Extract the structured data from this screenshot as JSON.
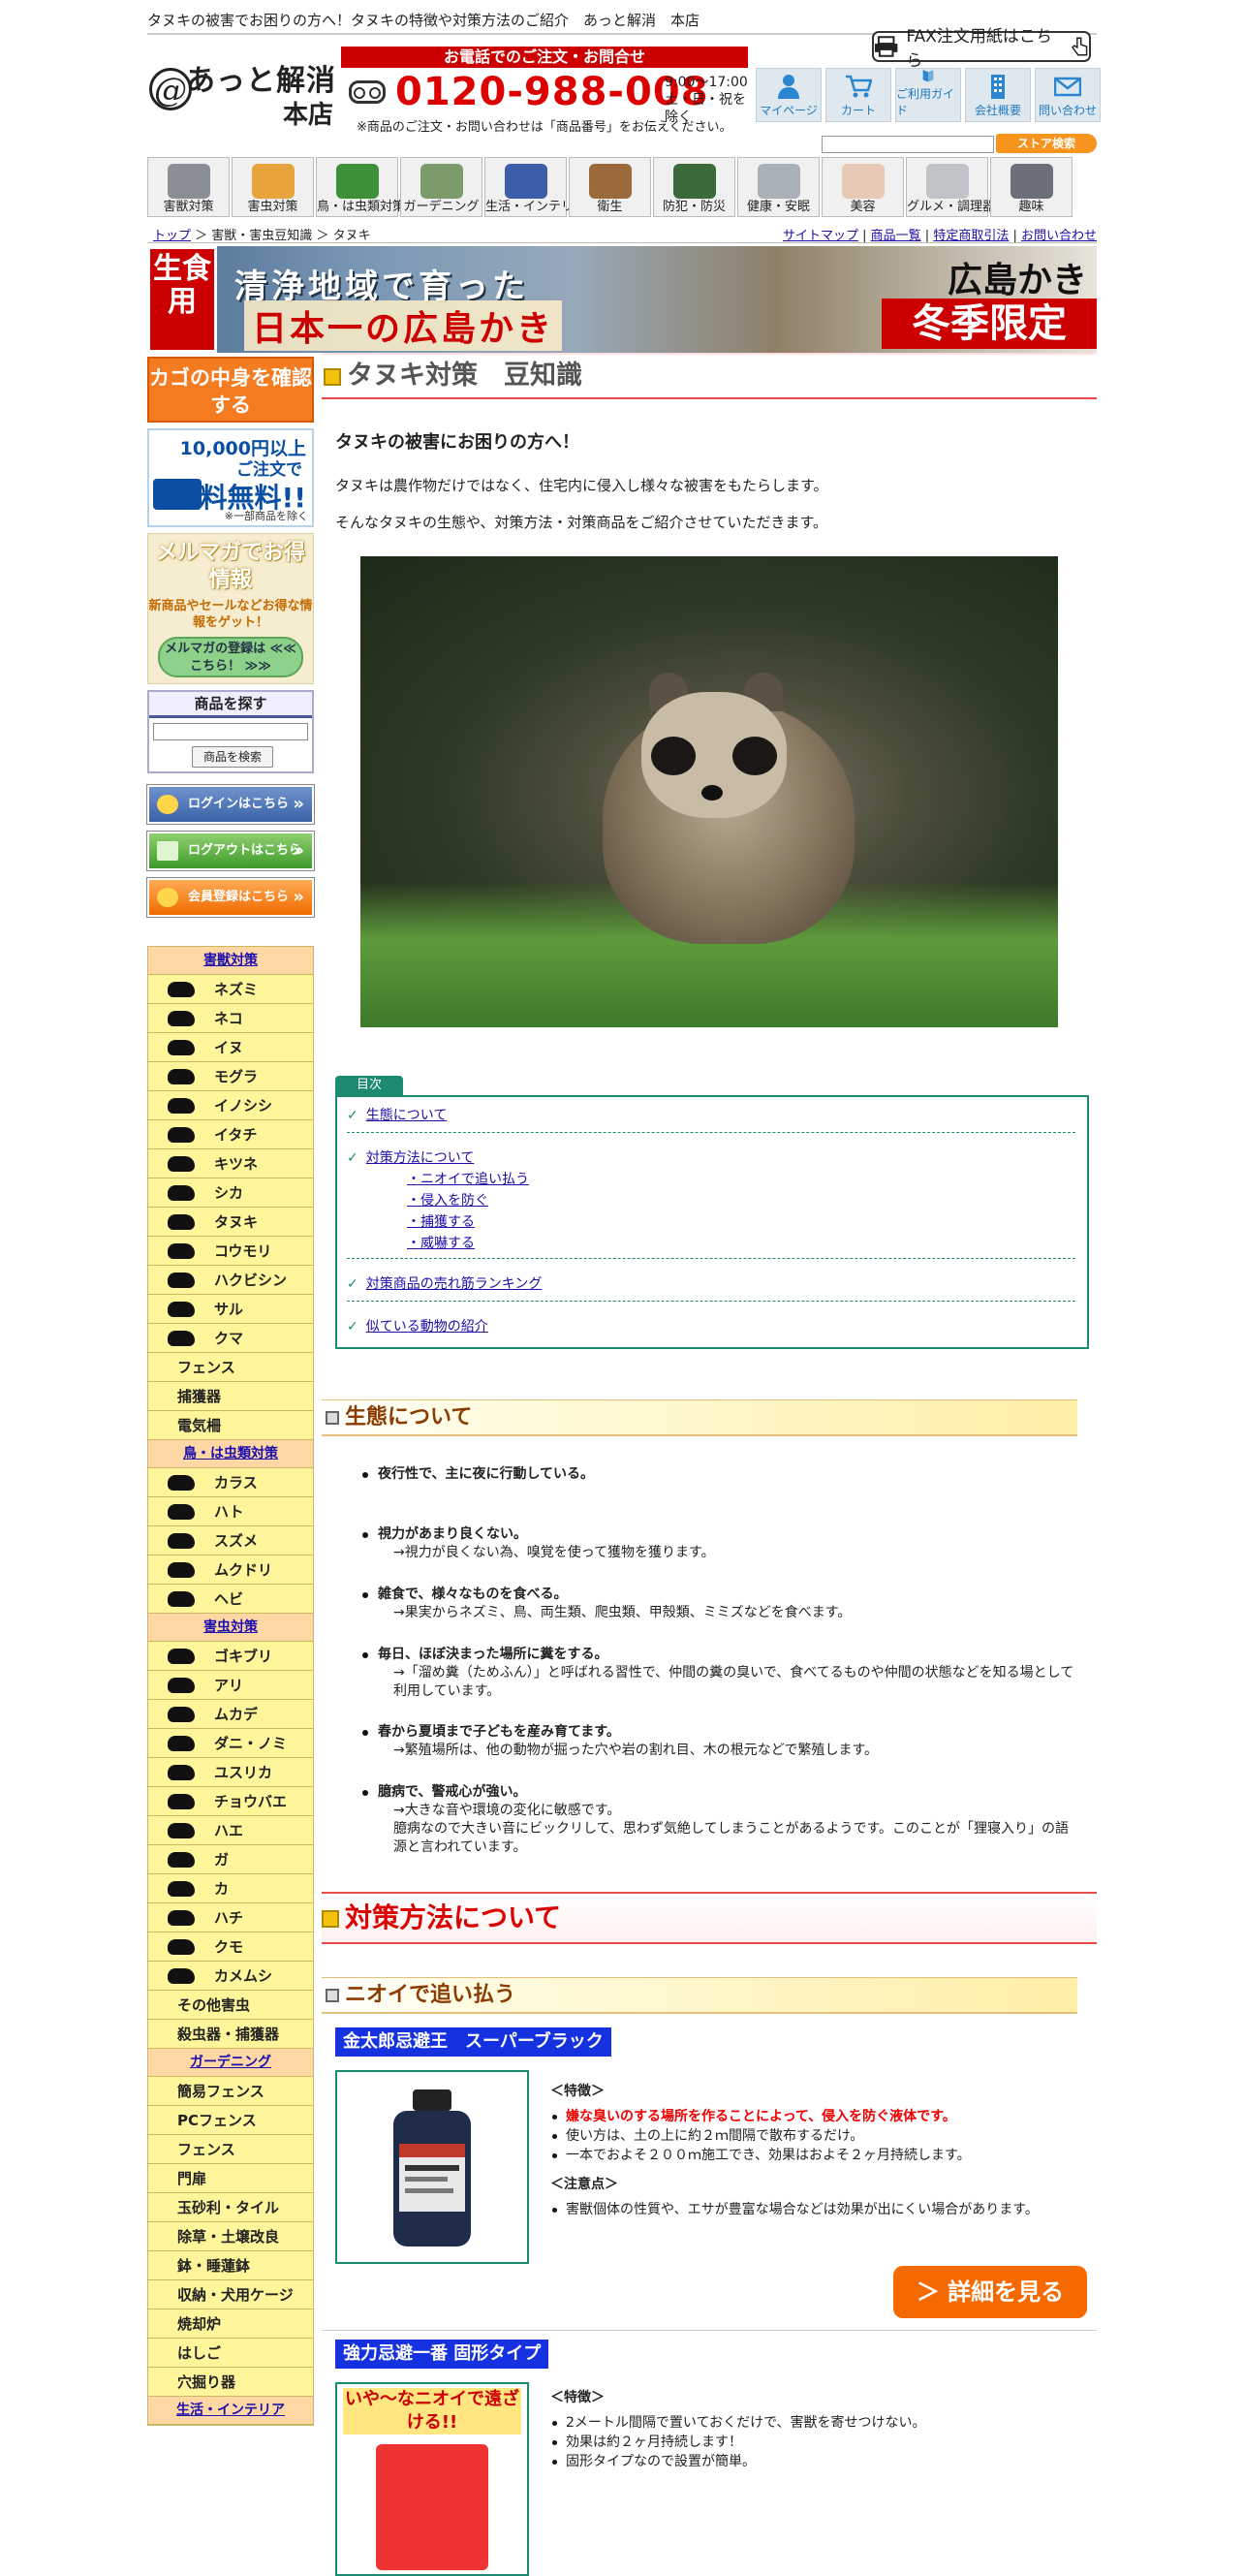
{
  "header": {
    "tagline": "タヌキの被害でお困りの方へ！タヌキの特徴や対策方法のご紹介　あっと解消　本店",
    "fax_button": "FAX注文用紙はこちら",
    "logo_mark": "@",
    "logo_line1": "あっと解消",
    "logo_line2": "本店",
    "phone_heading": "お電話でのご注文・お問合せ",
    "phone_number": "0120-988-008",
    "phone_hours_1": "9:00〜17:00",
    "phone_hours_2": "土・日・祝を除く",
    "phone_note": "※商品のご注文・お問い合わせは「商品番号」をお伝えください。",
    "nav": [
      "マイページ",
      "カート",
      "ご利用ガイド",
      "会社概要",
      "問い合わせ"
    ],
    "store_search_button": "ストア検索"
  },
  "categories": [
    "害獣対策",
    "害虫対策",
    "鳥・は虫類対策",
    "ガーデニング",
    "生活・インテリア",
    "衛生",
    "防犯・防災",
    "健康・安眠",
    "美容",
    "グルメ・調理器具",
    "趣味"
  ],
  "breadcrumb": {
    "top": "トップ",
    "sep1": " ＞ ",
    "mid": "害獣・害虫豆知識",
    "sep2": " ＞ ",
    "current": "タヌキ"
  },
  "top_links": [
    "サイトマップ",
    "商品一覧",
    "特定商取引法",
    "お問い合わせ"
  ],
  "banner": {
    "raw_label": "生食用",
    "line1": "清浄地域で育った",
    "line2": "日本一の広島かき",
    "right_title": "広島かき",
    "right_badge": "冬季限定"
  },
  "sidebar": {
    "cart_button": "カゴの中身を確認する",
    "free_ship_1": "10,000円以上",
    "free_ship_2": "ご注文で",
    "free_ship_3": "送料無料!!",
    "free_ship_note": "※一部商品を除く",
    "mailmag_title": "メルマガでお得情報",
    "mailmag_sub": "新商品やセールなどお得な情報をゲット！",
    "mailmag_button": "メルマガの登録は ≪≪ こちら！ ≫≫",
    "product_search_title": "商品を探す",
    "product_search_button": "商品を検索",
    "login": "ログインはこちら",
    "logout": "ログアウトはこちら",
    "register": "会員登録はこちら",
    "groups": [
      {
        "heading": "害獣対策",
        "items": [
          "ネズミ",
          "ネコ",
          "イヌ",
          "モグラ",
          "イノシシ",
          "イタチ",
          "キツネ",
          "シカ",
          "タヌキ",
          "コウモリ",
          "ハクビシン",
          "サル",
          "クマ"
        ],
        "plain": [
          "フェンス",
          "捕獲器",
          "電気柵"
        ]
      },
      {
        "heading": "鳥・は虫類対策",
        "items": [
          "カラス",
          "ハト",
          "スズメ",
          "ムクドリ",
          "ヘビ"
        ],
        "plain": []
      },
      {
        "heading": "害虫対策",
        "items": [
          "ゴキブリ",
          "アリ",
          "ムカデ",
          "ダニ・ノミ",
          "ユスリカ",
          "チョウバエ",
          "ハエ",
          "ガ",
          "カ",
          "ハチ",
          "クモ",
          "カメムシ"
        ],
        "plain": [
          "その他害虫",
          "殺虫器・捕獲器"
        ]
      },
      {
        "heading": "ガーデニング",
        "items": [],
        "plain": [
          "簡易フェンス",
          "PCフェンス",
          "フェンス",
          "門扉",
          "玉砂利・タイル",
          "除草・土壌改良",
          "鉢・睡蓮鉢",
          "収納・犬用ケージ",
          "焼却炉",
          "はしご",
          "穴掘り器"
        ]
      },
      {
        "heading": "生活・インテリア",
        "items": [],
        "plain": []
      }
    ]
  },
  "main": {
    "title": "タヌキ対策　豆知識",
    "intro_title": "タヌキの被害にお困りの方へ！",
    "intro_1": "タヌキは農作物だけではなく、住宅内に侵入し様々な被害をもたらします。",
    "intro_2": "そんなタヌキの生態や、対策方法・対策商品をご紹介させていただきます。",
    "toc_label": "目次",
    "toc": {
      "ecology": "生態について",
      "methods": "対策方法について",
      "methods_sub": [
        "・ニオイで追い払う",
        "・侵入を防ぐ",
        "・捕獲する",
        "・威嚇する"
      ],
      "ranking": "対策商品の売れ筋ランキング",
      "similar": "似ている動物の紹介"
    },
    "ecology_heading": "生態について",
    "ecology": [
      {
        "title": "夜行性で、主に夜に行動している。",
        "detail": []
      },
      {
        "title": "視力があまり良くない。",
        "detail": [
          "→視力が良くない為、嗅覚を使って獲物を獲ります。"
        ]
      },
      {
        "title": "雑食で、様々なものを食べる。",
        "detail": [
          "→果実からネズミ、鳥、両生類、爬虫類、甲殻類、ミミズなどを食べます。"
        ]
      },
      {
        "title": "毎日、ほぼ決まった場所に糞をする。",
        "detail": [
          "→「溜め糞（ためふん）」と呼ばれる習性で、仲間の糞の臭いで、食べてるものや仲間の状態などを知る場として利用しています。"
        ]
      },
      {
        "title": "春から夏頃まで子どもを産み育てます。",
        "detail": [
          "→繁殖場所は、他の動物が掘った穴や岩の割れ目、木の根元などで繁殖します。"
        ]
      },
      {
        "title": "臆病で、警戒心が強い。",
        "detail": [
          "→大きな音や環境の変化に敏感です。",
          "臆病なので大きい音にビックリして、思わず気絶してしまうことがあるようです。このことが「狸寝入り」の語源と言われています。"
        ]
      }
    ],
    "methods_heading": "対策方法について",
    "smell_heading": "ニオイで追い払う",
    "products": [
      {
        "name": "金太郎忌避王　スーパーブラック",
        "features_label": "＜特徴＞",
        "features": [
          "嫌な臭いのする場所を作ることによって、侵入を防ぐ液体です。",
          "使い方は、土の上に約２ｍ間隔で散布するだけ。",
          "一本でおよそ２００ｍ施工でき、効果はおよそ２ヶ月持続します。"
        ],
        "notes_label": "＜注意点＞",
        "notes": [
          "害獣個体の性質や、エサが豊富な場合などは効果が出にくい場合があります。"
        ]
      },
      {
        "name": "強力忌避一番 固形タイプ",
        "features_label": "＜特徴＞",
        "features": [
          "2メートル間隔で置いておくだけで、害獣を寄せつけない。",
          "効果は約２ヶ月持続します！",
          "固形タイプなので設置が簡単。"
        ],
        "image_text": "いや〜なニオイで遠ざける!!"
      }
    ],
    "detail_button": "＞ 詳細を見る"
  }
}
